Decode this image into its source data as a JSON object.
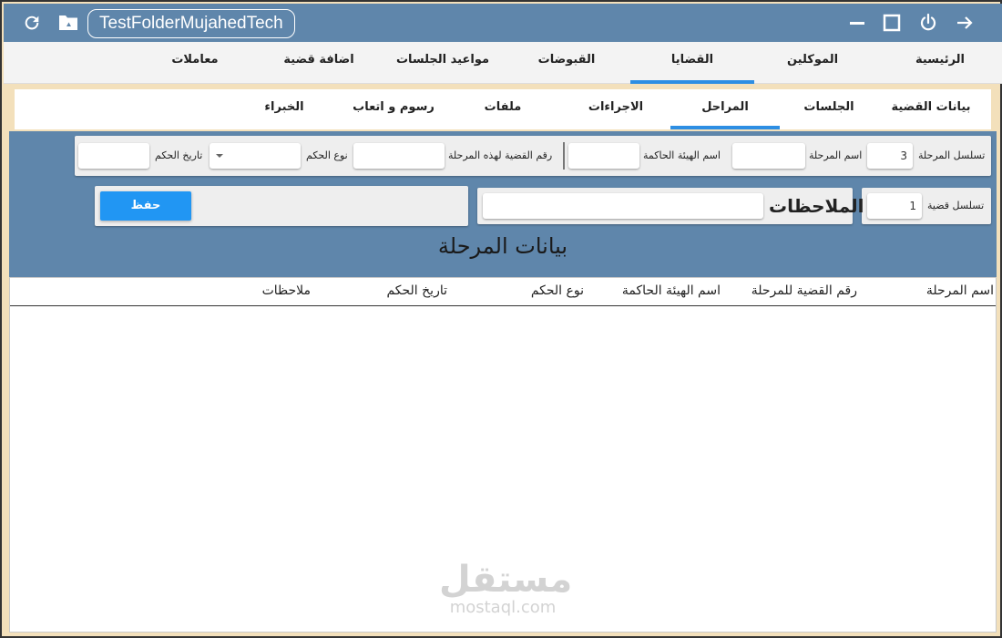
{
  "titlebar": {
    "folder_name": "TestFolderMujahedTech",
    "icons": [
      "refresh-icon",
      "drive-folder-icon",
      "minimize-icon",
      "maximize-icon",
      "power-icon",
      "arrow-right-icon"
    ]
  },
  "main_nav": {
    "tabs": [
      {
        "label": "الرئيسية"
      },
      {
        "label": "الموكلين"
      },
      {
        "label": "القضايا",
        "active": true
      },
      {
        "label": "القبوضات"
      },
      {
        "label": "مواعيد الجلسات"
      },
      {
        "label": "اضافة قضية"
      },
      {
        "label": "معاملات"
      }
    ]
  },
  "sub_nav": {
    "tabs": [
      {
        "label": "بيانات القضية"
      },
      {
        "label": "الجلسات"
      },
      {
        "label": "المراحل",
        "active": true
      },
      {
        "label": "الاجراءات"
      },
      {
        "label": "ملفات"
      },
      {
        "label": "رسوم و اتعاب"
      },
      {
        "label": "الخبراء"
      }
    ]
  },
  "form": {
    "stage_seq_label": "تسلسل المرحلة",
    "stage_seq_value": "3",
    "stage_name_label": "اسم المرحلة",
    "stage_name_value": "",
    "court_name_label": "اسم الهيئة الحاكمة",
    "court_name_value": "",
    "case_no_label": "رقم القضية لهذه المرحلة",
    "case_no_value": "",
    "verdict_type_label": "نوع الحكم",
    "verdict_type_value": "",
    "verdict_date_label": "تاريخ الحكم",
    "verdict_date_value": "",
    "case_seq_label": "تسلسل قضية",
    "case_seq_value": "1",
    "notes_label": "الملاحظات",
    "notes_value": "",
    "save_label": "حفظ"
  },
  "section_title": "بيانات المرحلة",
  "table": {
    "columns": [
      "اسم المرحلة",
      "رقم القضية للمرحلة",
      "اسم الهيئة الحاكمة",
      "نوع الحكم",
      "تاريخ الحكم",
      "ملاحظات"
    ],
    "rows": []
  },
  "watermark": {
    "arabic": "مستقل",
    "latin": "mostaql.com"
  },
  "colors": {
    "accent": "#2196f3",
    "titlebar": "#5f86ab",
    "frame_bg": "#f3e0bb"
  }
}
